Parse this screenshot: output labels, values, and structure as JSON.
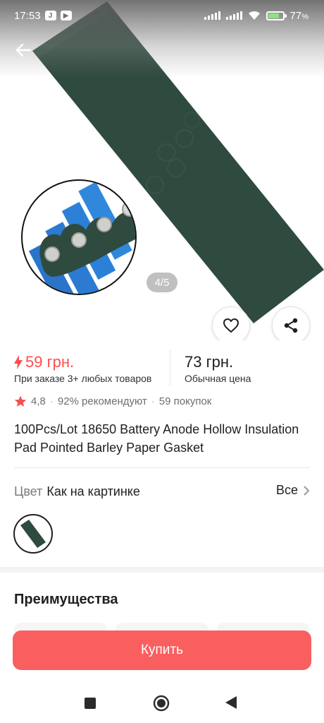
{
  "status_bar": {
    "time": "17:53",
    "app_badges": [
      "J",
      "▶"
    ],
    "battery": "77",
    "battery_unit": "%",
    "battery_level": 0.77
  },
  "gallery": {
    "counter": "4/5"
  },
  "prices": {
    "sale_price": "59 грн.",
    "sale_note": "При заказе 3+ любых товаров",
    "regular_price": "73 грн.",
    "regular_note": "Обычная цена"
  },
  "rating": {
    "value": "4,8",
    "recommend": "92% рекомендуют",
    "separator": "·",
    "purchases": "59 покупок"
  },
  "product": {
    "title": "100Pcs/Lot 18650 Battery Anode Hollow Insulation Pad Pointed Barley Paper Gasket"
  },
  "color": {
    "label": "Цвет",
    "value": "Как на картинке",
    "all_label": "Все"
  },
  "benefits": {
    "title": "Преимущества"
  },
  "buy_button": {
    "label": "Купить"
  },
  "colors": {
    "accent": "#fa5f5f",
    "sale_price": "#ff4e4e",
    "paper": "#2f4a3e"
  }
}
